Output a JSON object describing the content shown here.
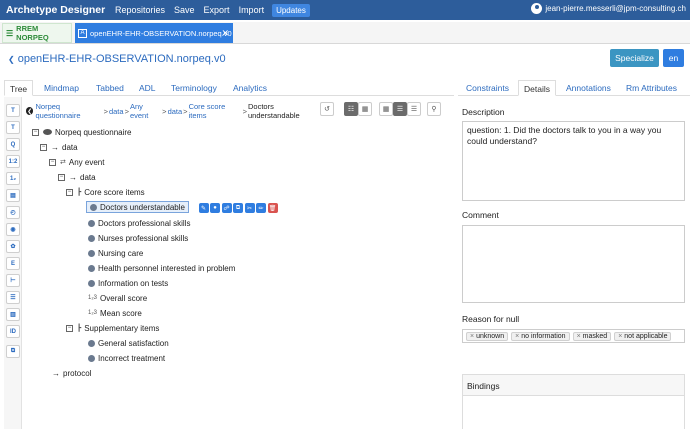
{
  "navbar": {
    "brand": "Archetype Designer",
    "items": [
      "Repositories",
      "Save",
      "Export",
      "Import"
    ],
    "updates": "Updates",
    "user": "jean-pierre.messerli@jpm-consulting.ch"
  },
  "archetype_tabs": {
    "repo_tab": "RREM NORPEQ",
    "open_tab": "openEHR-EHR-OBSERVATION.norpeq.v0"
  },
  "title": {
    "archetype_id": "openEHR-EHR-OBSERVATION.norpeq.v0",
    "specialize": "Specialize",
    "language": "en"
  },
  "main_tabs": [
    "Tree",
    "Mindmap",
    "Tabbed",
    "ADL",
    "Terminology",
    "Analytics"
  ],
  "right_tabs": [
    "Constraints",
    "Details",
    "Annotations",
    "Rm Attributes"
  ],
  "toolbar_icons": [
    "type-t-icon",
    "text-t-icon",
    "quantity-icon",
    "ratio-icon",
    "count-icon",
    "date-icon",
    "clock-icon",
    "boolean-icon",
    "coded-text-icon",
    "cluster-icon",
    "structure-icon",
    "slot-icon",
    "multimedia-icon",
    "identifier-icon",
    "copy-icon"
  ],
  "toolbar_labels": [
    "T",
    "T",
    "Q",
    "1:2",
    "1₂",
    "▤",
    "◴",
    "◉",
    "✿",
    "E",
    "⊢",
    "☰",
    "▥",
    "ID",
    "⧉"
  ],
  "breadcrumb": {
    "items": [
      "Norpeq questionnaire",
      "data",
      "Any event",
      "data",
      "Core score items"
    ],
    "current": "Doctors understandable"
  },
  "tree": {
    "root": "Norpeq questionnaire",
    "data1": "data",
    "any_event": "Any event",
    "data2": "data",
    "core_score_items": "Core score items",
    "core_items": [
      "Doctors understandable",
      "Doctors professional skills",
      "Nurses professional skills",
      "Nursing care",
      "Health personnel interested in problem",
      "Information on tests",
      "Overall score",
      "Mean score"
    ],
    "supplementary_items": "Supplementary items",
    "supp_items": [
      "General satisfaction",
      "Incorrect treatment"
    ],
    "protocol": "protocol"
  },
  "details": {
    "description_label": "Description",
    "description": "question: 1. Did the doctors talk to you in a way you could understand?",
    "comment_label": "Comment",
    "comment": "",
    "null_label": "Reason for null",
    "null_reasons": [
      "unknown",
      "no information",
      "masked",
      "not applicable"
    ],
    "bindings_label": "Bindings"
  },
  "colors": {
    "navbar": "#2d5d9b",
    "primary": "#2f7de0",
    "link": "#2c6bbf",
    "danger": "#d9534f",
    "specialize": "#3b95c2"
  }
}
